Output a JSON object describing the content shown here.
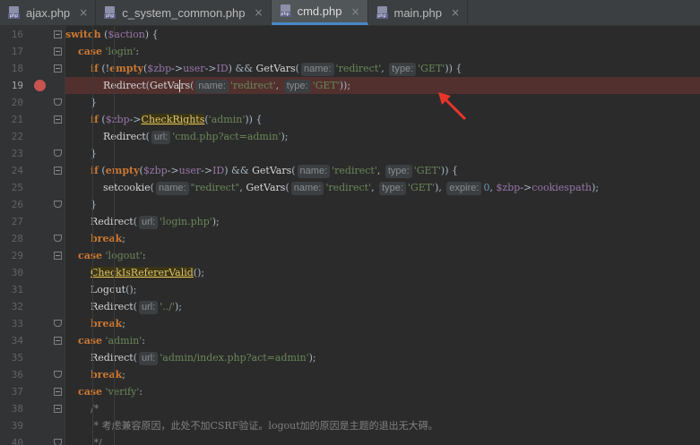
{
  "tabs": [
    {
      "label": "ajax.php",
      "active": false,
      "file_type": "php",
      "close": "×"
    },
    {
      "label": "c_system_common.php",
      "active": false,
      "file_type": "php",
      "close": "×"
    },
    {
      "label": "cmd.php",
      "active": true,
      "file_type": "php",
      "close": "×"
    },
    {
      "label": "main.php",
      "active": false,
      "file_type": "php",
      "close": "×"
    }
  ],
  "current_line": "19",
  "breakpoint_line": "19",
  "lines": [
    {
      "n": "16",
      "fold": "open",
      "tokens": [
        [
          "kw",
          "switch"
        ],
        [
          "p",
          " ("
        ],
        [
          "vr",
          "$action"
        ],
        [
          "p",
          ") {"
        ]
      ]
    },
    {
      "n": "17",
      "fold": "open",
      "tokens": [
        [
          "p",
          "    "
        ],
        [
          "kw",
          "case"
        ],
        [
          "p",
          " "
        ],
        [
          "st",
          "'login'"
        ],
        [
          "p",
          ":"
        ]
      ]
    },
    {
      "n": "18",
      "fold": "open",
      "tokens": [
        [
          "p",
          "        "
        ],
        [
          "kw",
          "if"
        ],
        [
          "p",
          " (!"
        ],
        [
          "kw",
          "empty"
        ],
        [
          "p",
          "("
        ],
        [
          "vr",
          "$zbp"
        ],
        [
          "p",
          "->"
        ],
        [
          "vr",
          "user"
        ],
        [
          "p",
          "->"
        ],
        [
          "vr",
          "ID"
        ],
        [
          "p",
          ") && "
        ],
        [
          "fn",
          "GetVars"
        ],
        [
          "p",
          "("
        ],
        [
          "hint",
          "name:"
        ],
        [
          "st",
          "'redirect'"
        ],
        [
          "p",
          ", "
        ],
        [
          "hint",
          "type:"
        ],
        [
          "st",
          "'GET'"
        ],
        [
          "p",
          ")) {"
        ]
      ]
    },
    {
      "n": "19",
      "fold": "",
      "tokens": [
        [
          "p",
          "            "
        ],
        [
          "fn",
          "Redirect"
        ],
        [
          "p",
          "("
        ],
        [
          "fn",
          "GetVa"
        ],
        [
          "caret",
          ""
        ],
        [
          "fn",
          "rs"
        ],
        [
          "p",
          "("
        ],
        [
          "hint",
          "name:"
        ],
        [
          "st",
          "'redirect'"
        ],
        [
          "p",
          ", "
        ],
        [
          "hint",
          "type:"
        ],
        [
          "st",
          "'GET'"
        ],
        [
          "p",
          "));"
        ]
      ]
    },
    {
      "n": "20",
      "fold": "end",
      "tokens": [
        [
          "p",
          "        }"
        ]
      ]
    },
    {
      "n": "21",
      "fold": "open",
      "tokens": [
        [
          "p",
          "        "
        ],
        [
          "kw",
          "if"
        ],
        [
          "p",
          " ("
        ],
        [
          "vr",
          "$zbp"
        ],
        [
          "p",
          "->"
        ],
        [
          "yel",
          "CheckRights"
        ],
        [
          "p",
          "("
        ],
        [
          "st",
          "'admin'"
        ],
        [
          "p",
          ")) {"
        ]
      ]
    },
    {
      "n": "22",
      "fold": "",
      "tokens": [
        [
          "p",
          "            "
        ],
        [
          "fn",
          "Redirect"
        ],
        [
          "p",
          "("
        ],
        [
          "hint",
          "url:"
        ],
        [
          "st",
          "'cmd.php?act=admin'"
        ],
        [
          "p",
          ");"
        ]
      ]
    },
    {
      "n": "23",
      "fold": "end",
      "tokens": [
        [
          "p",
          "        }"
        ]
      ]
    },
    {
      "n": "24",
      "fold": "open",
      "tokens": [
        [
          "p",
          "        "
        ],
        [
          "kw",
          "if"
        ],
        [
          "p",
          " ("
        ],
        [
          "kw",
          "empty"
        ],
        [
          "p",
          "("
        ],
        [
          "vr",
          "$zbp"
        ],
        [
          "p",
          "->"
        ],
        [
          "vr",
          "user"
        ],
        [
          "p",
          "->"
        ],
        [
          "vr",
          "ID"
        ],
        [
          "p",
          ") && "
        ],
        [
          "fn",
          "GetVars"
        ],
        [
          "p",
          "("
        ],
        [
          "hint",
          "name:"
        ],
        [
          "st",
          "'redirect'"
        ],
        [
          "p",
          ", "
        ],
        [
          "hint",
          "type:"
        ],
        [
          "st",
          "'GET'"
        ],
        [
          "p",
          ")) {"
        ]
      ]
    },
    {
      "n": "25",
      "fold": "",
      "tokens": [
        [
          "p",
          "            "
        ],
        [
          "fn",
          "setcookie"
        ],
        [
          "p",
          "("
        ],
        [
          "hint",
          "name:"
        ],
        [
          "st",
          "\"redirect\""
        ],
        [
          "p",
          ", "
        ],
        [
          "fn",
          "GetVars"
        ],
        [
          "p",
          "("
        ],
        [
          "hint",
          "name:"
        ],
        [
          "st",
          "'redirect'"
        ],
        [
          "p",
          ", "
        ],
        [
          "hint",
          "type:"
        ],
        [
          "st",
          "'GET'"
        ],
        [
          "p",
          "), "
        ],
        [
          "hint",
          "expire:"
        ],
        [
          "num",
          "0"
        ],
        [
          "p",
          ", "
        ],
        [
          "vr",
          "$zbp"
        ],
        [
          "p",
          "->"
        ],
        [
          "vr",
          "cookiespath"
        ],
        [
          "p",
          ");"
        ]
      ]
    },
    {
      "n": "26",
      "fold": "end",
      "tokens": [
        [
          "p",
          "        }"
        ]
      ]
    },
    {
      "n": "27",
      "fold": "",
      "tokens": [
        [
          "p",
          "        "
        ],
        [
          "fn",
          "Redirect"
        ],
        [
          "p",
          "("
        ],
        [
          "hint",
          "url:"
        ],
        [
          "st",
          "'login.php'"
        ],
        [
          "p",
          ");"
        ]
      ]
    },
    {
      "n": "28",
      "fold": "end",
      "tokens": [
        [
          "p",
          "        "
        ],
        [
          "kw",
          "break"
        ],
        [
          "p",
          ";"
        ]
      ]
    },
    {
      "n": "29",
      "fold": "open",
      "tokens": [
        [
          "p",
          "    "
        ],
        [
          "kw",
          "case"
        ],
        [
          "p",
          " "
        ],
        [
          "st",
          "'logout'"
        ],
        [
          "p",
          ":"
        ]
      ]
    },
    {
      "n": "30",
      "fold": "",
      "tokens": [
        [
          "p",
          "        "
        ],
        [
          "yel",
          "CheckIsRefererValid"
        ],
        [
          "p",
          "();"
        ]
      ]
    },
    {
      "n": "31",
      "fold": "",
      "tokens": [
        [
          "p",
          "        "
        ],
        [
          "fn",
          "Logout"
        ],
        [
          "p",
          "();"
        ]
      ]
    },
    {
      "n": "32",
      "fold": "",
      "tokens": [
        [
          "p",
          "        "
        ],
        [
          "fn",
          "Redirect"
        ],
        [
          "p",
          "("
        ],
        [
          "hint",
          "url:"
        ],
        [
          "st",
          "'../'"
        ],
        [
          "p",
          ");"
        ]
      ]
    },
    {
      "n": "33",
      "fold": "end",
      "tokens": [
        [
          "p",
          "        "
        ],
        [
          "kw",
          "break"
        ],
        [
          "p",
          ";"
        ]
      ]
    },
    {
      "n": "34",
      "fold": "open",
      "tokens": [
        [
          "p",
          "    "
        ],
        [
          "kw",
          "case"
        ],
        [
          "p",
          " "
        ],
        [
          "st",
          "'admin'"
        ],
        [
          "p",
          ":"
        ]
      ]
    },
    {
      "n": "35",
      "fold": "",
      "tokens": [
        [
          "p",
          "        "
        ],
        [
          "fn",
          "Redirect"
        ],
        [
          "p",
          "("
        ],
        [
          "hint",
          "url:"
        ],
        [
          "st",
          "'admin/index.php?act=admin'"
        ],
        [
          "p",
          ");"
        ]
      ]
    },
    {
      "n": "36",
      "fold": "end",
      "tokens": [
        [
          "p",
          "        "
        ],
        [
          "kw",
          "break"
        ],
        [
          "p",
          ";"
        ]
      ]
    },
    {
      "n": "37",
      "fold": "open",
      "tokens": [
        [
          "p",
          "    "
        ],
        [
          "kw",
          "case"
        ],
        [
          "p",
          " "
        ],
        [
          "st",
          "'verify'"
        ],
        [
          "p",
          ":"
        ]
      ]
    },
    {
      "n": "38",
      "fold": "open",
      "tokens": [
        [
          "p",
          "        "
        ],
        [
          "cm",
          "/*"
        ]
      ]
    },
    {
      "n": "39",
      "fold": "",
      "tokens": [
        [
          "p",
          "         "
        ],
        [
          "cm",
          "* 考虑兼容原因，此处不加CSRF验证。logout加的原因是主题的退出无大碍。"
        ]
      ]
    },
    {
      "n": "40",
      "fold": "end",
      "tokens": [
        [
          "p",
          "         "
        ],
        [
          "cm",
          "*/"
        ]
      ]
    }
  ],
  "colors": {
    "breakpoint": "#c75450",
    "arrow": "#e8352b",
    "highlight_line": "#52302e",
    "accent_tab": "#4a88c7"
  },
  "icons": {
    "tab_file": "php-file-icon",
    "tab_close": "close-icon",
    "annotation": "red-arrow-icon"
  }
}
